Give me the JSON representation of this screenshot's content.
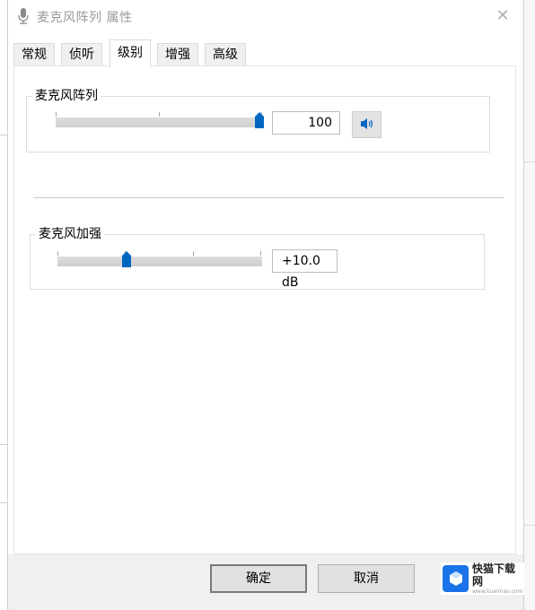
{
  "window": {
    "title": "麦克风阵列 属性",
    "close_label": "✕"
  },
  "tabs": [
    {
      "label": "常规",
      "active": false
    },
    {
      "label": "侦听",
      "active": false
    },
    {
      "label": "级别",
      "active": true
    },
    {
      "label": "增强",
      "active": false
    },
    {
      "label": "高级",
      "active": false
    }
  ],
  "levels": {
    "mic_array": {
      "title": "麦克风阵列",
      "value_text": "100",
      "level": 1.0,
      "muted": false
    },
    "mic_boost": {
      "title": "麦克风加强",
      "value_text": "+10.0 dB",
      "level": 0.33
    }
  },
  "footer": {
    "ok_label": "确定",
    "cancel_label": "取消"
  },
  "watermark": {
    "name": "快猫下载网",
    "url": "www.kuaimao.com"
  },
  "colors": {
    "accent": "#0067c0",
    "track": "#d4d4d4"
  }
}
